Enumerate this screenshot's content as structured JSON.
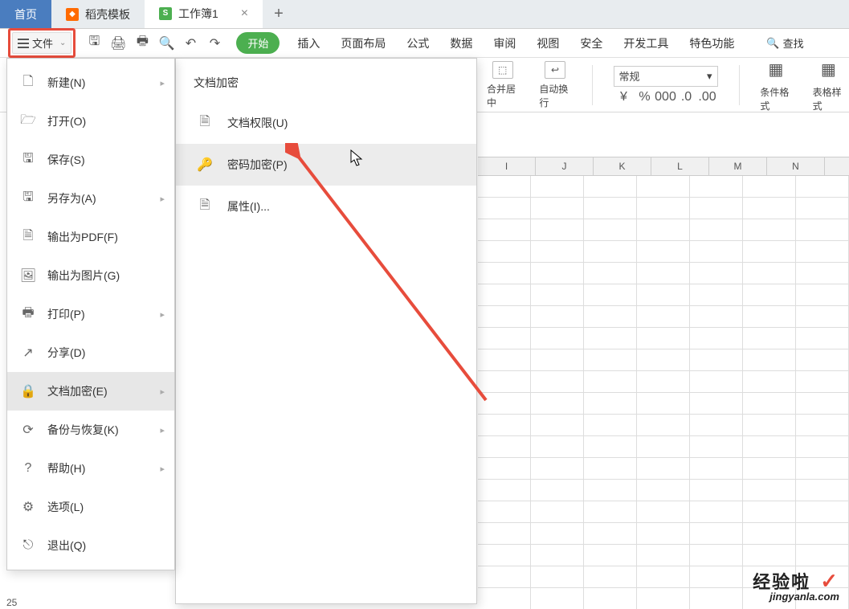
{
  "tabs": {
    "home": "首页",
    "docer": "稻壳模板",
    "workbook": "工作簿1"
  },
  "file_button": "文件",
  "ribbon": {
    "start": "开始",
    "insert": "插入",
    "page_layout": "页面布局",
    "formula": "公式",
    "data": "数据",
    "review": "审阅",
    "view": "视图",
    "security": "安全",
    "dev_tools": "开发工具",
    "special": "特色功能",
    "find": "查找"
  },
  "ribbon_content": {
    "merge_center": "合并居中",
    "auto_wrap": "自动换行",
    "number_format": "常规",
    "cond_format": "条件格式",
    "table_style": "表格样式"
  },
  "column_headers": [
    "I",
    "J",
    "K",
    "L",
    "M",
    "N"
  ],
  "row25": "25",
  "file_menu": {
    "new": "新建(N)",
    "open": "打开(O)",
    "save": "保存(S)",
    "save_as": "另存为(A)",
    "export_pdf": "输出为PDF(F)",
    "export_image": "输出为图片(G)",
    "print": "打印(P)",
    "share": "分享(D)",
    "encrypt": "文档加密(E)",
    "backup": "备份与恢复(K)",
    "help": "帮助(H)",
    "options": "选项(L)",
    "exit": "退出(Q)"
  },
  "submenu": {
    "title": "文档加密",
    "permission": "文档权限(U)",
    "password": "密码加密(P)",
    "properties": "属性(I)..."
  },
  "watermark": {
    "top": "经验啦",
    "bottom": "jingyanla.com"
  }
}
